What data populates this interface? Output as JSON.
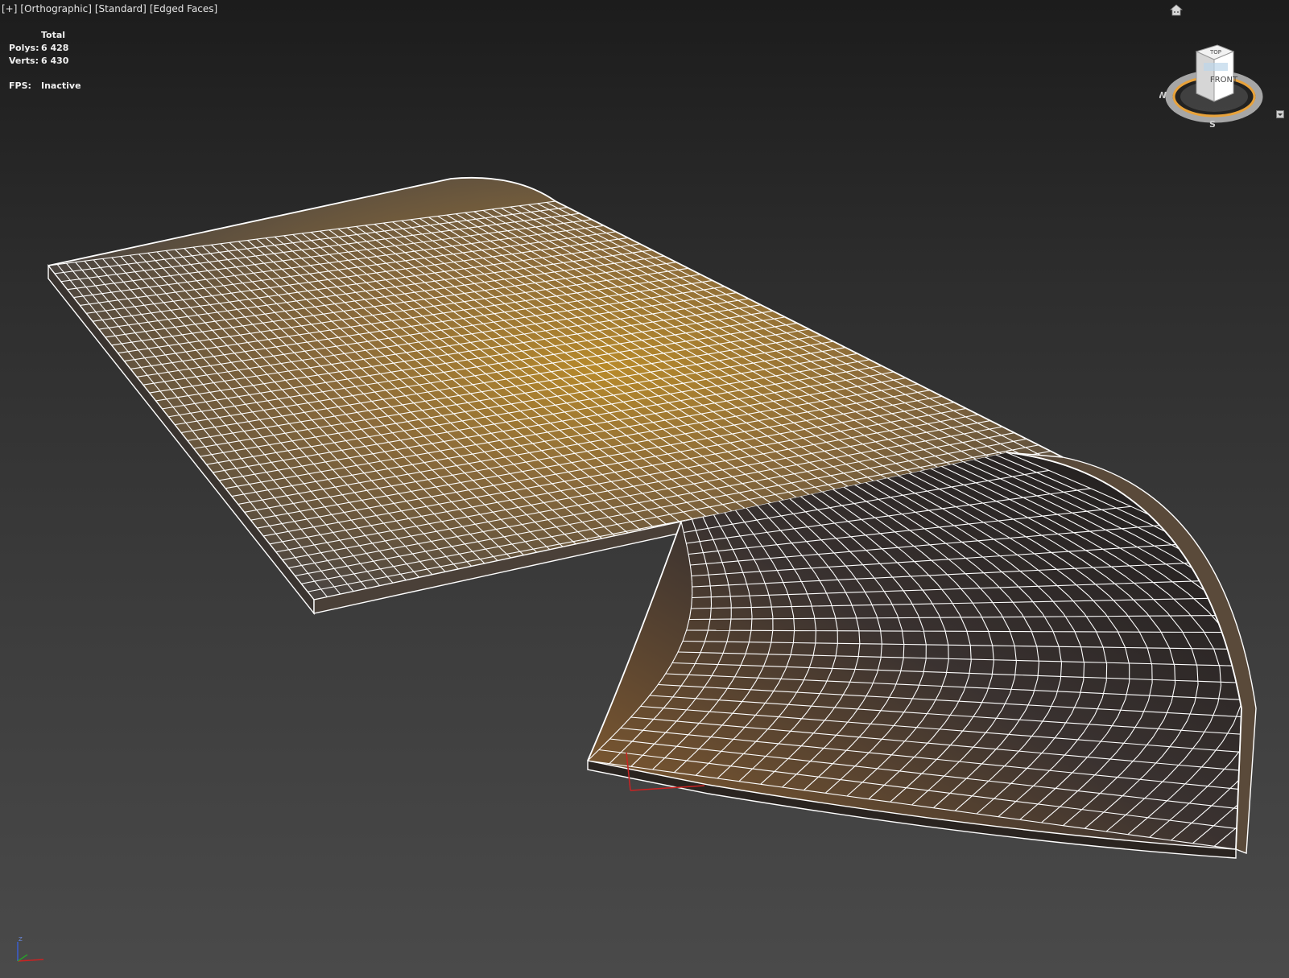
{
  "viewport": {
    "labels": [
      "[+]",
      "[Orthographic]",
      "[Standard]",
      "[Edged Faces]"
    ]
  },
  "stats": {
    "header": "Total",
    "polys_label": "Polys:",
    "polys_value": "6 428",
    "verts_label": "Verts:",
    "verts_value": "6 430",
    "fps_label": "FPS:",
    "fps_value": "Inactive"
  },
  "viewcube": {
    "top_label": "TOP",
    "front_label": "FRONT",
    "compass_w": "W",
    "compass_s": "S"
  },
  "axes": {
    "z_label": "Z"
  },
  "colors": {
    "wire": "#ffffff",
    "texture_warm": "#a8741f",
    "texture_dark": "#2c2622",
    "gizmo_x": "#cc2222",
    "gizmo_y": "#2aa02a",
    "gizmo_z": "#3a5fd0",
    "compass_ring": "#e8a23a"
  },
  "icons": [
    "home-icon",
    "viewcube-icon",
    "menu-dropdown-icon",
    "axis-tripod-icon"
  ]
}
